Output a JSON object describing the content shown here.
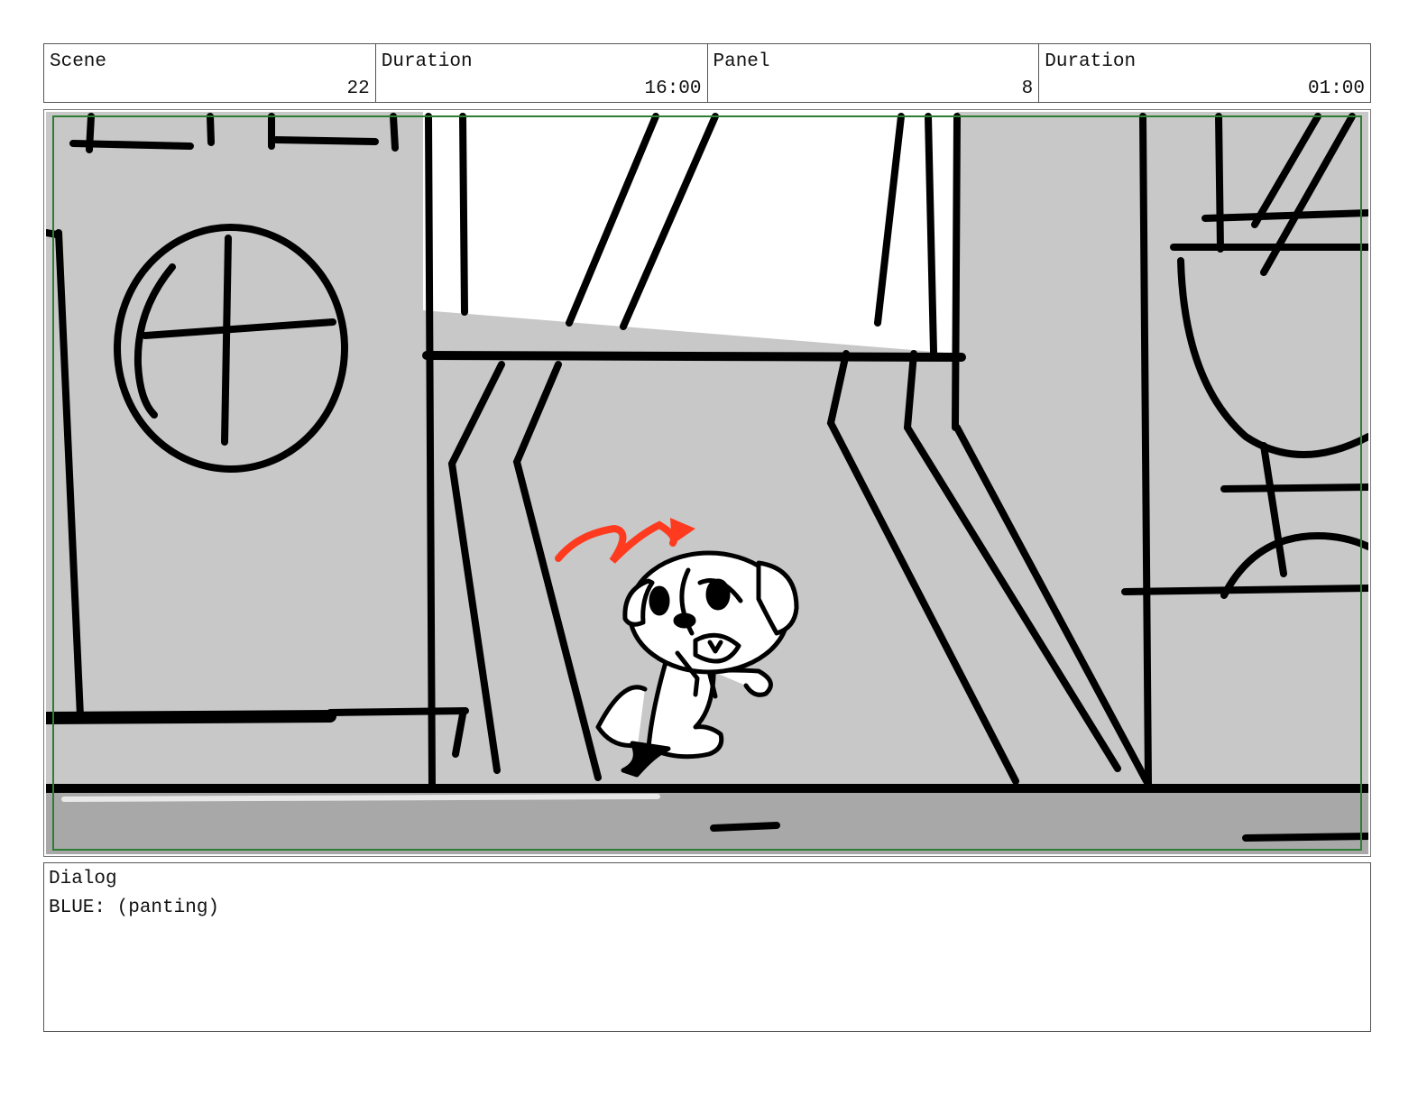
{
  "header": {
    "scene_label": "Scene",
    "scene_value": "22",
    "scene_duration_label": "Duration",
    "scene_duration_value": "16:00",
    "panel_label": "Panel",
    "panel_value": "8",
    "panel_duration_label": "Duration",
    "panel_duration_value": "01:00"
  },
  "dialog": {
    "label": "Dialog",
    "text": "BLUE: (panting)"
  },
  "colors": {
    "safe_frame": "#2e7d32",
    "motion_arrow": "#ff3b1f",
    "wall_gray": "#c8c8c8",
    "floor_gray": "#a8a8a8"
  }
}
